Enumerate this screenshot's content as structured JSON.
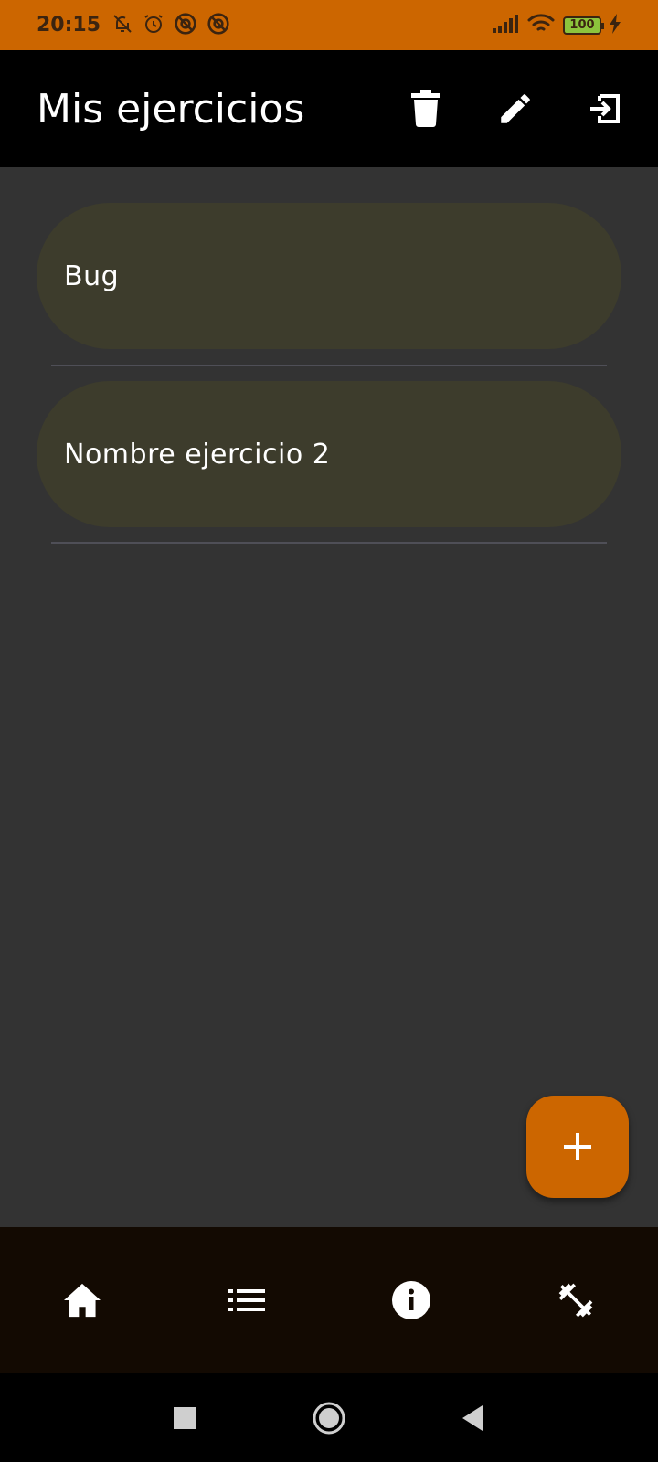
{
  "status_bar": {
    "time": "20:15",
    "battery": "100",
    "left_icons": [
      "bell-off-icon",
      "alarm-icon",
      "no-signal-icon",
      "no-signal-icon"
    ],
    "right_icons": [
      "cell-signal-icon",
      "wifi-icon",
      "battery-icon",
      "charging-icon"
    ]
  },
  "app_bar": {
    "title": "Mis ejercicios",
    "actions": [
      "delete-icon",
      "edit-icon",
      "logout-icon"
    ]
  },
  "exercises": [
    {
      "name": "Bug"
    },
    {
      "name": "Nombre ejercicio 2"
    }
  ],
  "fab": {
    "icon": "add-icon"
  },
  "bottom_nav": {
    "items": [
      "home-icon",
      "list-icon",
      "info-icon",
      "fitness-icon"
    ]
  },
  "system_nav": {
    "items": [
      "recents-icon",
      "home-circle-icon",
      "back-icon"
    ]
  },
  "colors": {
    "accent": "#CC6600",
    "background": "#333333",
    "card": "#3d3c2c",
    "app_bar": "#000000",
    "bottom_nav": "#130a02"
  }
}
